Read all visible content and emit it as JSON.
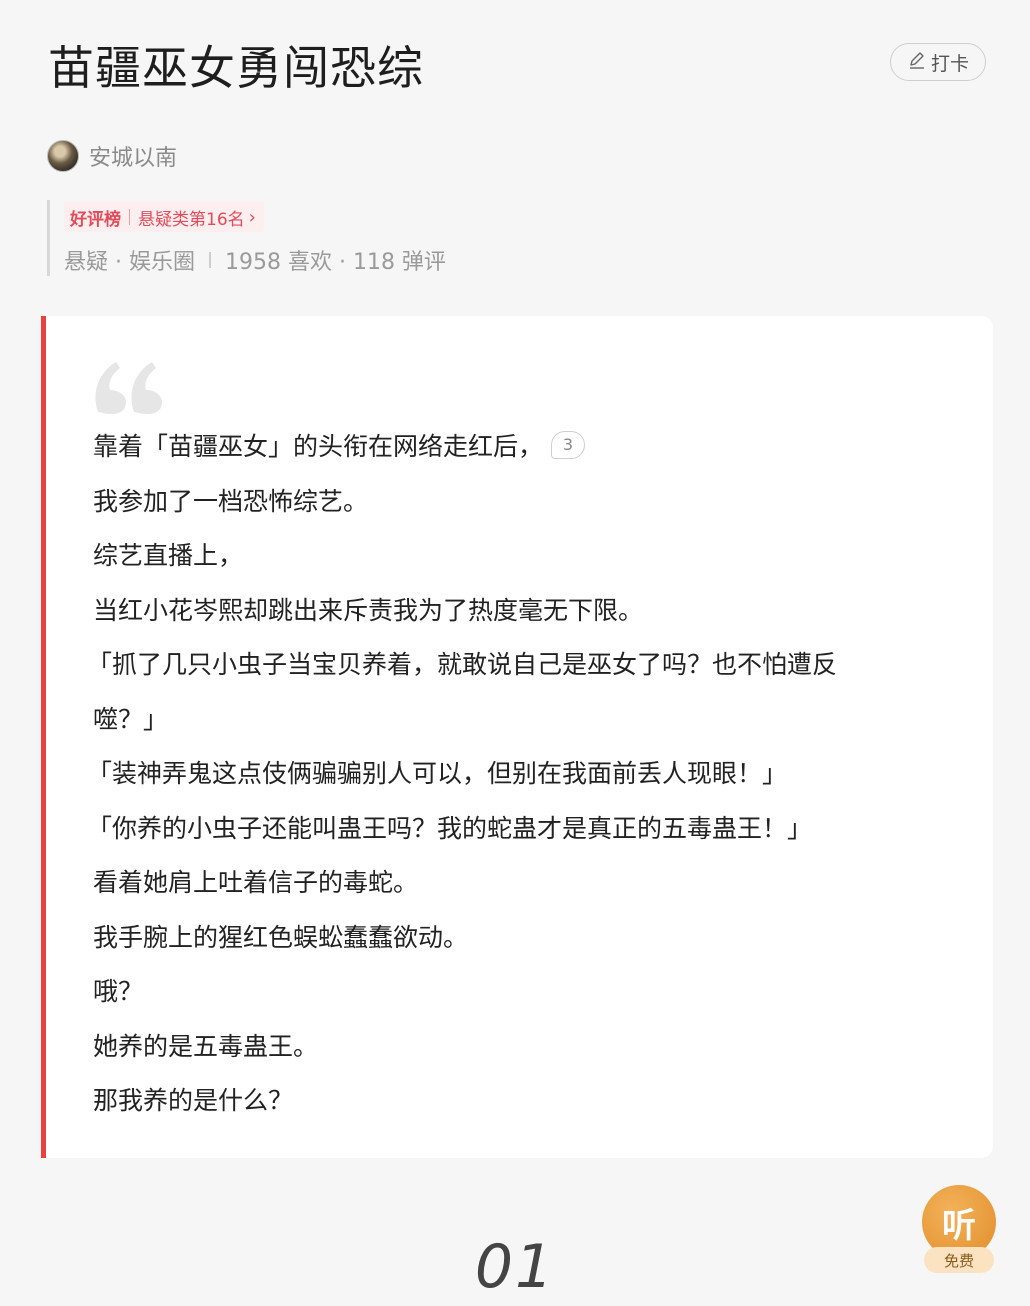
{
  "book": {
    "title": "苗疆巫女勇闯恐综",
    "checkin_label": "打卡",
    "author": "安城以南"
  },
  "rank": {
    "list_name": "好评榜",
    "position": "悬疑类第16名"
  },
  "stats": {
    "genres": "悬疑 · 娱乐圈",
    "likes": "1958 喜欢 · 118 弹评"
  },
  "excerpt": {
    "comment_count": "3",
    "lines": [
      "靠着「苗疆巫女」的头衔在网络走红后，",
      "我参加了一档恐怖综艺。",
      "综艺直播上，",
      "当红小花岑熙却跳出来斥责我为了热度毫无下限。",
      "「抓了几只小虫子当宝贝养着，就敢说自己是巫女了吗？也不怕遭反",
      "噬？」",
      "「装神弄鬼这点伎俩骗骗别人可以，但别在我面前丢人现眼！」",
      "「你养的小虫子还能叫蛊王吗？我的蛇蛊才是真正的五毒蛊王！」",
      "看着她肩上吐着信子的毒蛇。",
      "我手腕上的猩红色蜈蚣蠢蠢欲动。",
      "哦？",
      "她养的是五毒蛊王。",
      "那我养的是什么？"
    ]
  },
  "chapter": {
    "number": "01"
  },
  "listen": {
    "icon_label": "听",
    "tag": "免费"
  },
  "colors": {
    "accent_red": "#e8413e",
    "rank_red": "#e24c5a",
    "listen_orange": "#e08d2a"
  }
}
